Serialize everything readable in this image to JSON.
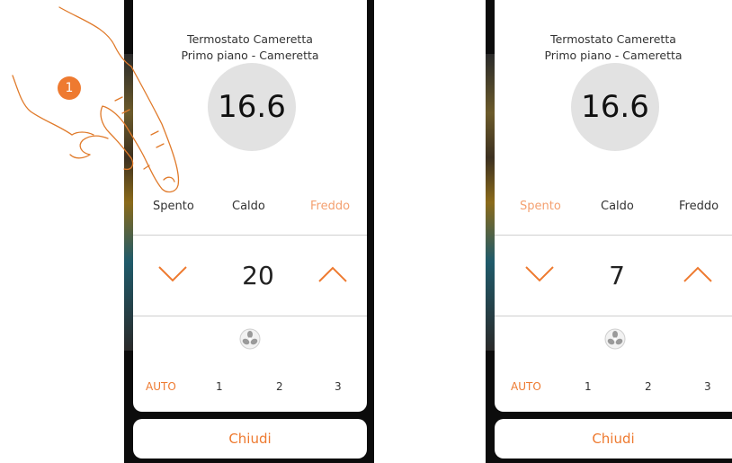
{
  "screens": [
    {
      "title_line1": "Termostato Cameretta",
      "title_line2": "Primo piano - Cameretta",
      "temperature": "16.6",
      "modes": [
        "Spento",
        "Caldo",
        "Freddo"
      ],
      "active_mode": "Freddo",
      "setpoint": "20",
      "fan_speeds": [
        "AUTO",
        "1",
        "2",
        "3"
      ],
      "active_fan_speed": "AUTO",
      "close_label": "Chiudi"
    },
    {
      "title_line1": "Termostato Cameretta",
      "title_line2": "Primo piano - Cameretta",
      "temperature": "16.6",
      "modes": [
        "Spento",
        "Caldo",
        "Freddo"
      ],
      "active_mode": "Spento",
      "setpoint": "7",
      "fan_speeds": [
        "AUTO",
        "1",
        "2",
        "3"
      ],
      "active_fan_speed": "AUTO",
      "close_label": "Chiudi"
    }
  ],
  "step_badge": "1",
  "colors": {
    "accent": "#ee7a30",
    "accent_light": "#f4a070",
    "circle": "#e2e2e2"
  }
}
